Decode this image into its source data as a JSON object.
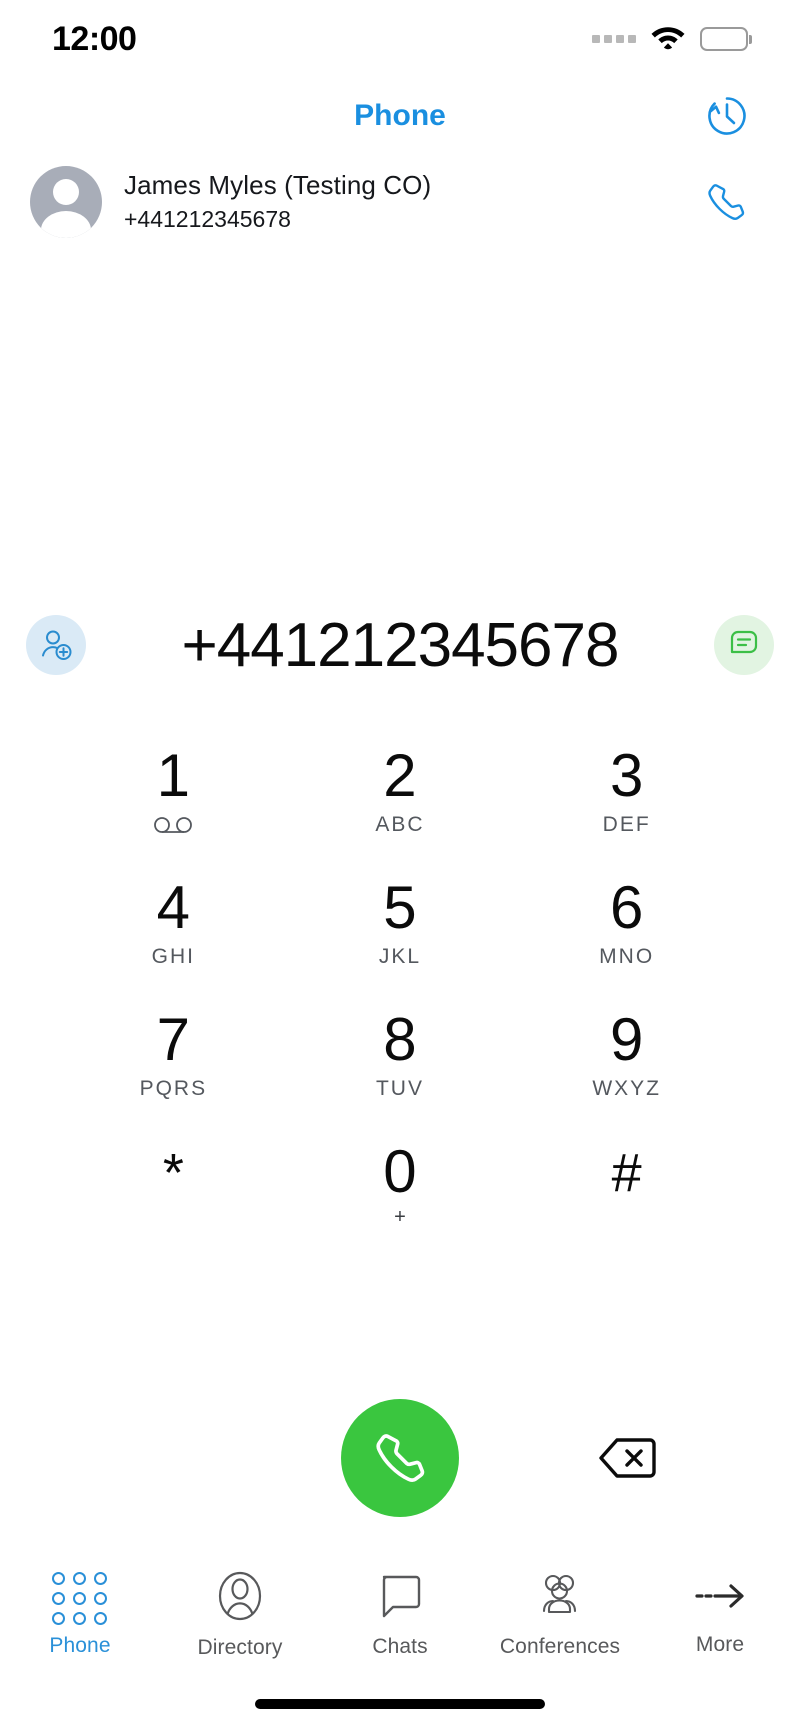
{
  "status_bar": {
    "time": "12:00",
    "signal_icon": "signal-dots-icon",
    "wifi_icon": "wifi-icon",
    "battery_icon": "battery-full-icon"
  },
  "nav": {
    "title": "Phone",
    "history_icon": "call-history-clock-icon"
  },
  "contact": {
    "avatar_icon": "person-avatar-icon",
    "name": "James  Myles (Testing CO)",
    "number": "+441212345678",
    "call_icon": "phone-handset-icon"
  },
  "number_display": {
    "value": "+441212345678",
    "add_contact_icon": "add-contact-icon",
    "message_icon": "message-bubble-icon"
  },
  "keypad": {
    "keys": [
      {
        "digit": "1",
        "sub": "",
        "icon": "voicemail-icon"
      },
      {
        "digit": "2",
        "sub": "ABC",
        "icon": ""
      },
      {
        "digit": "3",
        "sub": "DEF",
        "icon": ""
      },
      {
        "digit": "4",
        "sub": "GHI",
        "icon": ""
      },
      {
        "digit": "5",
        "sub": "JKL",
        "icon": ""
      },
      {
        "digit": "6",
        "sub": "MNO",
        "icon": ""
      },
      {
        "digit": "7",
        "sub": "PQRS",
        "icon": ""
      },
      {
        "digit": "8",
        "sub": "TUV",
        "icon": ""
      },
      {
        "digit": "9",
        "sub": "WXYZ",
        "icon": ""
      },
      {
        "digit": "*",
        "sub": "",
        "icon": ""
      },
      {
        "digit": "0",
        "sub": "+",
        "icon": ""
      },
      {
        "digit": "#",
        "sub": "",
        "icon": ""
      }
    ]
  },
  "actions": {
    "call_icon": "phone-handset-icon",
    "backspace_icon": "backspace-delete-icon",
    "call_button_color": "#3ac63f"
  },
  "tabbar": {
    "active_color": "#2a90d8",
    "inactive_color": "#58595b",
    "items": [
      {
        "label": "Phone",
        "icon": "keypad-dots-icon",
        "active": true
      },
      {
        "label": "Directory",
        "icon": "person-outline-icon",
        "active": false
      },
      {
        "label": "Chats",
        "icon": "chat-bubble-icon",
        "active": false
      },
      {
        "label": "Conferences",
        "icon": "group-people-icon",
        "active": false
      },
      {
        "label": "More",
        "icon": "arrow-right-dashed-icon",
        "active": false
      }
    ]
  },
  "home_indicator": "home-indicator-bar"
}
